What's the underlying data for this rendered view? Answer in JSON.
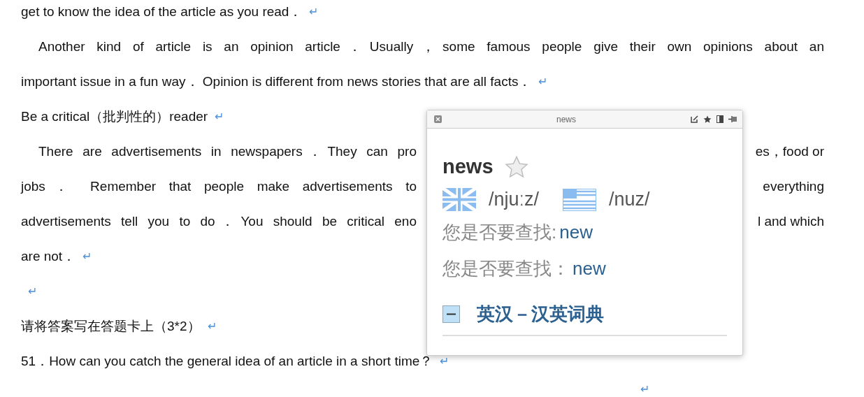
{
  "document": {
    "lines": [
      {
        "text": "get to know the idea of the article as you read．",
        "mark": "↵"
      },
      {
        "text": "Another kind of article is an opinion article．Usually，some famous people give their own opinions about an"
      },
      {
        "text": "important issue in a fun way． Opinion is different from news stories that are all facts．",
        "mark": "↵"
      },
      {
        "text": "Be a critical（批判性的）reader",
        "mark": "↵"
      },
      {
        "text": "There are advertisements in newspapers．They can pro",
        "after": "es，food or"
      },
      {
        "text": "jobs． Remember that people make advertisements to",
        "after": "everything"
      },
      {
        "text": "advertisements tell you to do．You should be critical eno",
        "after": "l and which"
      },
      {
        "text": "are not．",
        "mark": "↵"
      },
      {
        "mark": "↵"
      },
      {
        "text": "请将答案写在答题卡上（3*2）",
        "mark": "↵"
      },
      {
        "text": "51．How can you catch the general idea of an article in a short time？",
        "mark": "↵"
      },
      {
        "mark": "↵"
      }
    ]
  },
  "popup": {
    "title": "news",
    "word": "news",
    "pronunciations": [
      {
        "kind": "uk",
        "phonetic": "/njuːz/"
      },
      {
        "kind": "us",
        "phonetic": "/nuz/"
      }
    ],
    "suggestions": [
      {
        "prompt": "您是否要查找:",
        "word": "new"
      },
      {
        "prompt": "您是否要查找：",
        "word": "new"
      }
    ],
    "section": {
      "title": "英汉－汉英词典",
      "expanded": true
    }
  }
}
